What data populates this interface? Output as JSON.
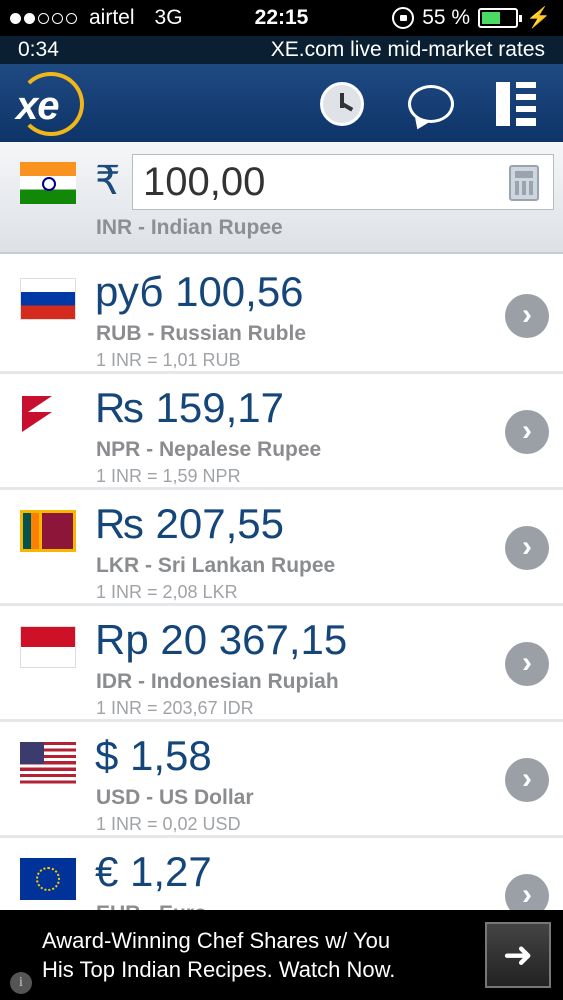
{
  "status_bar": {
    "carrier": "airtel",
    "network": "3G",
    "time": "22:15",
    "battery_percent": "55 %",
    "battery_level": 0.55
  },
  "info_bar": {
    "timer": "0:34",
    "rates_text": "XE.com live mid-market rates"
  },
  "header": {
    "logo_text": "xe"
  },
  "base": {
    "symbol": "₹",
    "amount": "100,00",
    "name": "INR - Indian Rupee"
  },
  "rows": [
    {
      "symbol_value": "руб 100,56",
      "name": "RUB - Russian Ruble",
      "rate": "1 INR = 1,01 RUB"
    },
    {
      "symbol_value": "₨ 159,17",
      "name": "NPR - Nepalese Rupee",
      "rate": "1 INR = 1,59 NPR"
    },
    {
      "symbol_value": "₨ 207,55",
      "name": "LKR - Sri Lankan Rupee",
      "rate": "1 INR = 2,08 LKR"
    },
    {
      "symbol_value": "Rp 20 367,15",
      "name": "IDR - Indonesian Rupiah",
      "rate": "1 INR = 203,67 IDR"
    },
    {
      "symbol_value": "$ 1,58",
      "name": "USD - US Dollar",
      "rate": "1 INR = 0,02 USD"
    },
    {
      "symbol_value": "€ 1,27",
      "name": "EUR - Euro",
      "rate": ""
    }
  ],
  "ad": {
    "line1": "Award-Winning Chef Shares w/ You",
    "line2": "His Top Indian Recipes. Watch Now."
  }
}
